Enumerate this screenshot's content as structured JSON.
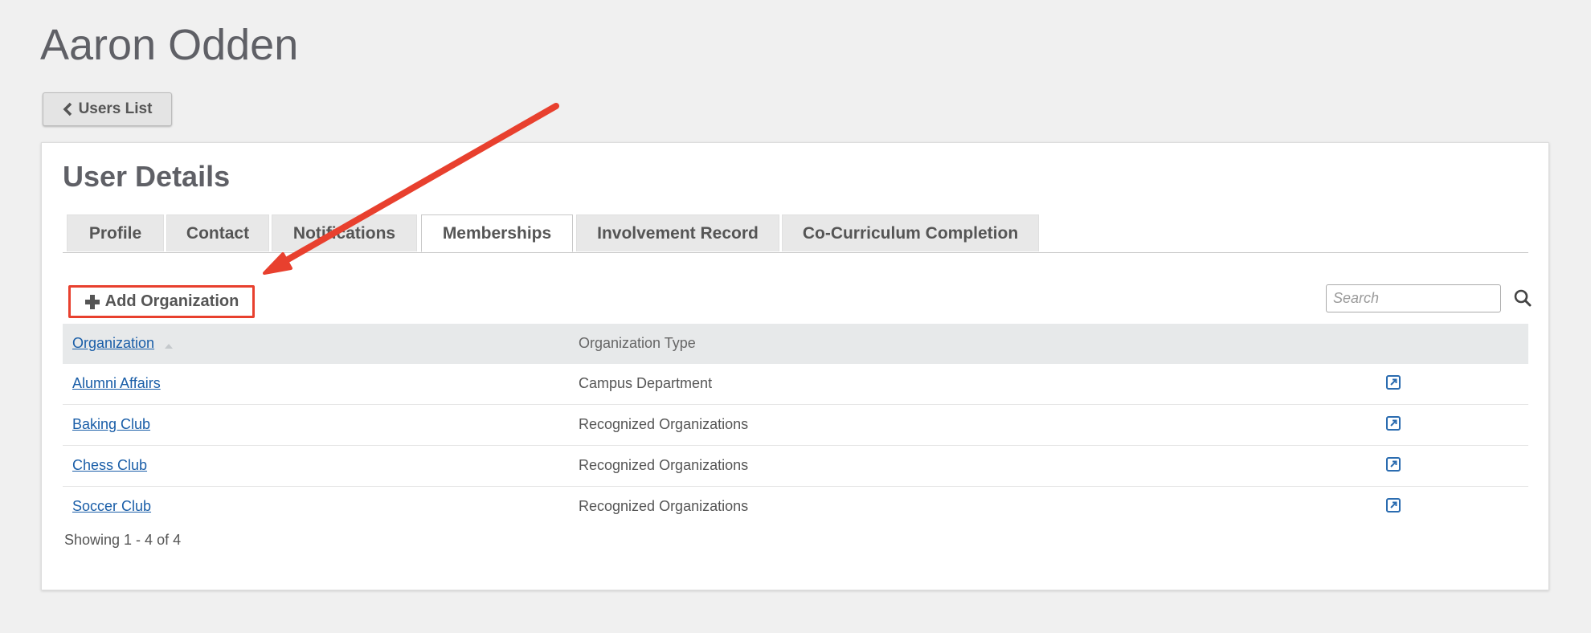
{
  "page": {
    "title": "Aaron Odden"
  },
  "back_button": {
    "label": "Users List"
  },
  "card": {
    "title": "User Details"
  },
  "tabs": [
    {
      "label": "Profile"
    },
    {
      "label": "Contact"
    },
    {
      "label": "Notifications"
    },
    {
      "label": "Memberships",
      "active": true
    },
    {
      "label": "Involvement Record"
    },
    {
      "label": "Co-Curriculum Completion"
    }
  ],
  "toolbar": {
    "add_label": "Add Organization",
    "search_placeholder": "Search"
  },
  "table": {
    "headers": {
      "organization": "Organization",
      "type": "Organization Type"
    },
    "rows": [
      {
        "organization": "Alumni Affairs",
        "type": "Campus Department"
      },
      {
        "organization": "Baking Club",
        "type": "Recognized Organizations"
      },
      {
        "organization": "Chess Club",
        "type": "Recognized Organizations"
      },
      {
        "organization": "Soccer Club",
        "type": "Recognized Organizations"
      }
    ]
  },
  "pagination": {
    "summary": "Showing 1 - 4 of 4"
  },
  "icons": {
    "back": "chevron-left-icon",
    "add": "plus-icon",
    "search": "search-icon",
    "sort": "sort-up-icon",
    "row_action": "external-link-icon",
    "annotation": "red-arrow-annotation"
  },
  "colors": {
    "link": "#1a5ea8",
    "annotation": "#e8402e",
    "header_bg": "#e7e9ea"
  }
}
